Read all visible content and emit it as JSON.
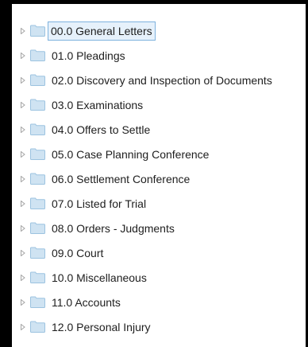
{
  "tree": {
    "selected_index": 0,
    "folder_color": "#cfe3f2",
    "folder_stroke": "#9cc3e0",
    "expander_icon": "triangle-right-icon",
    "folder_icon": "folder-icon",
    "items": [
      {
        "label": "00.0 General Letters"
      },
      {
        "label": "01.0 Pleadings"
      },
      {
        "label": "02.0 Discovery and Inspection of Documents"
      },
      {
        "label": "03.0 Examinations"
      },
      {
        "label": "04.0 Offers to Settle"
      },
      {
        "label": "05.0 Case Planning Conference"
      },
      {
        "label": "06.0 Settlement Conference"
      },
      {
        "label": "07.0 Listed for Trial"
      },
      {
        "label": "08.0 Orders - Judgments"
      },
      {
        "label": "09.0 Court"
      },
      {
        "label": "10.0 Miscellaneous"
      },
      {
        "label": "11.0 Accounts"
      },
      {
        "label": "12.0 Personal Injury"
      }
    ]
  }
}
